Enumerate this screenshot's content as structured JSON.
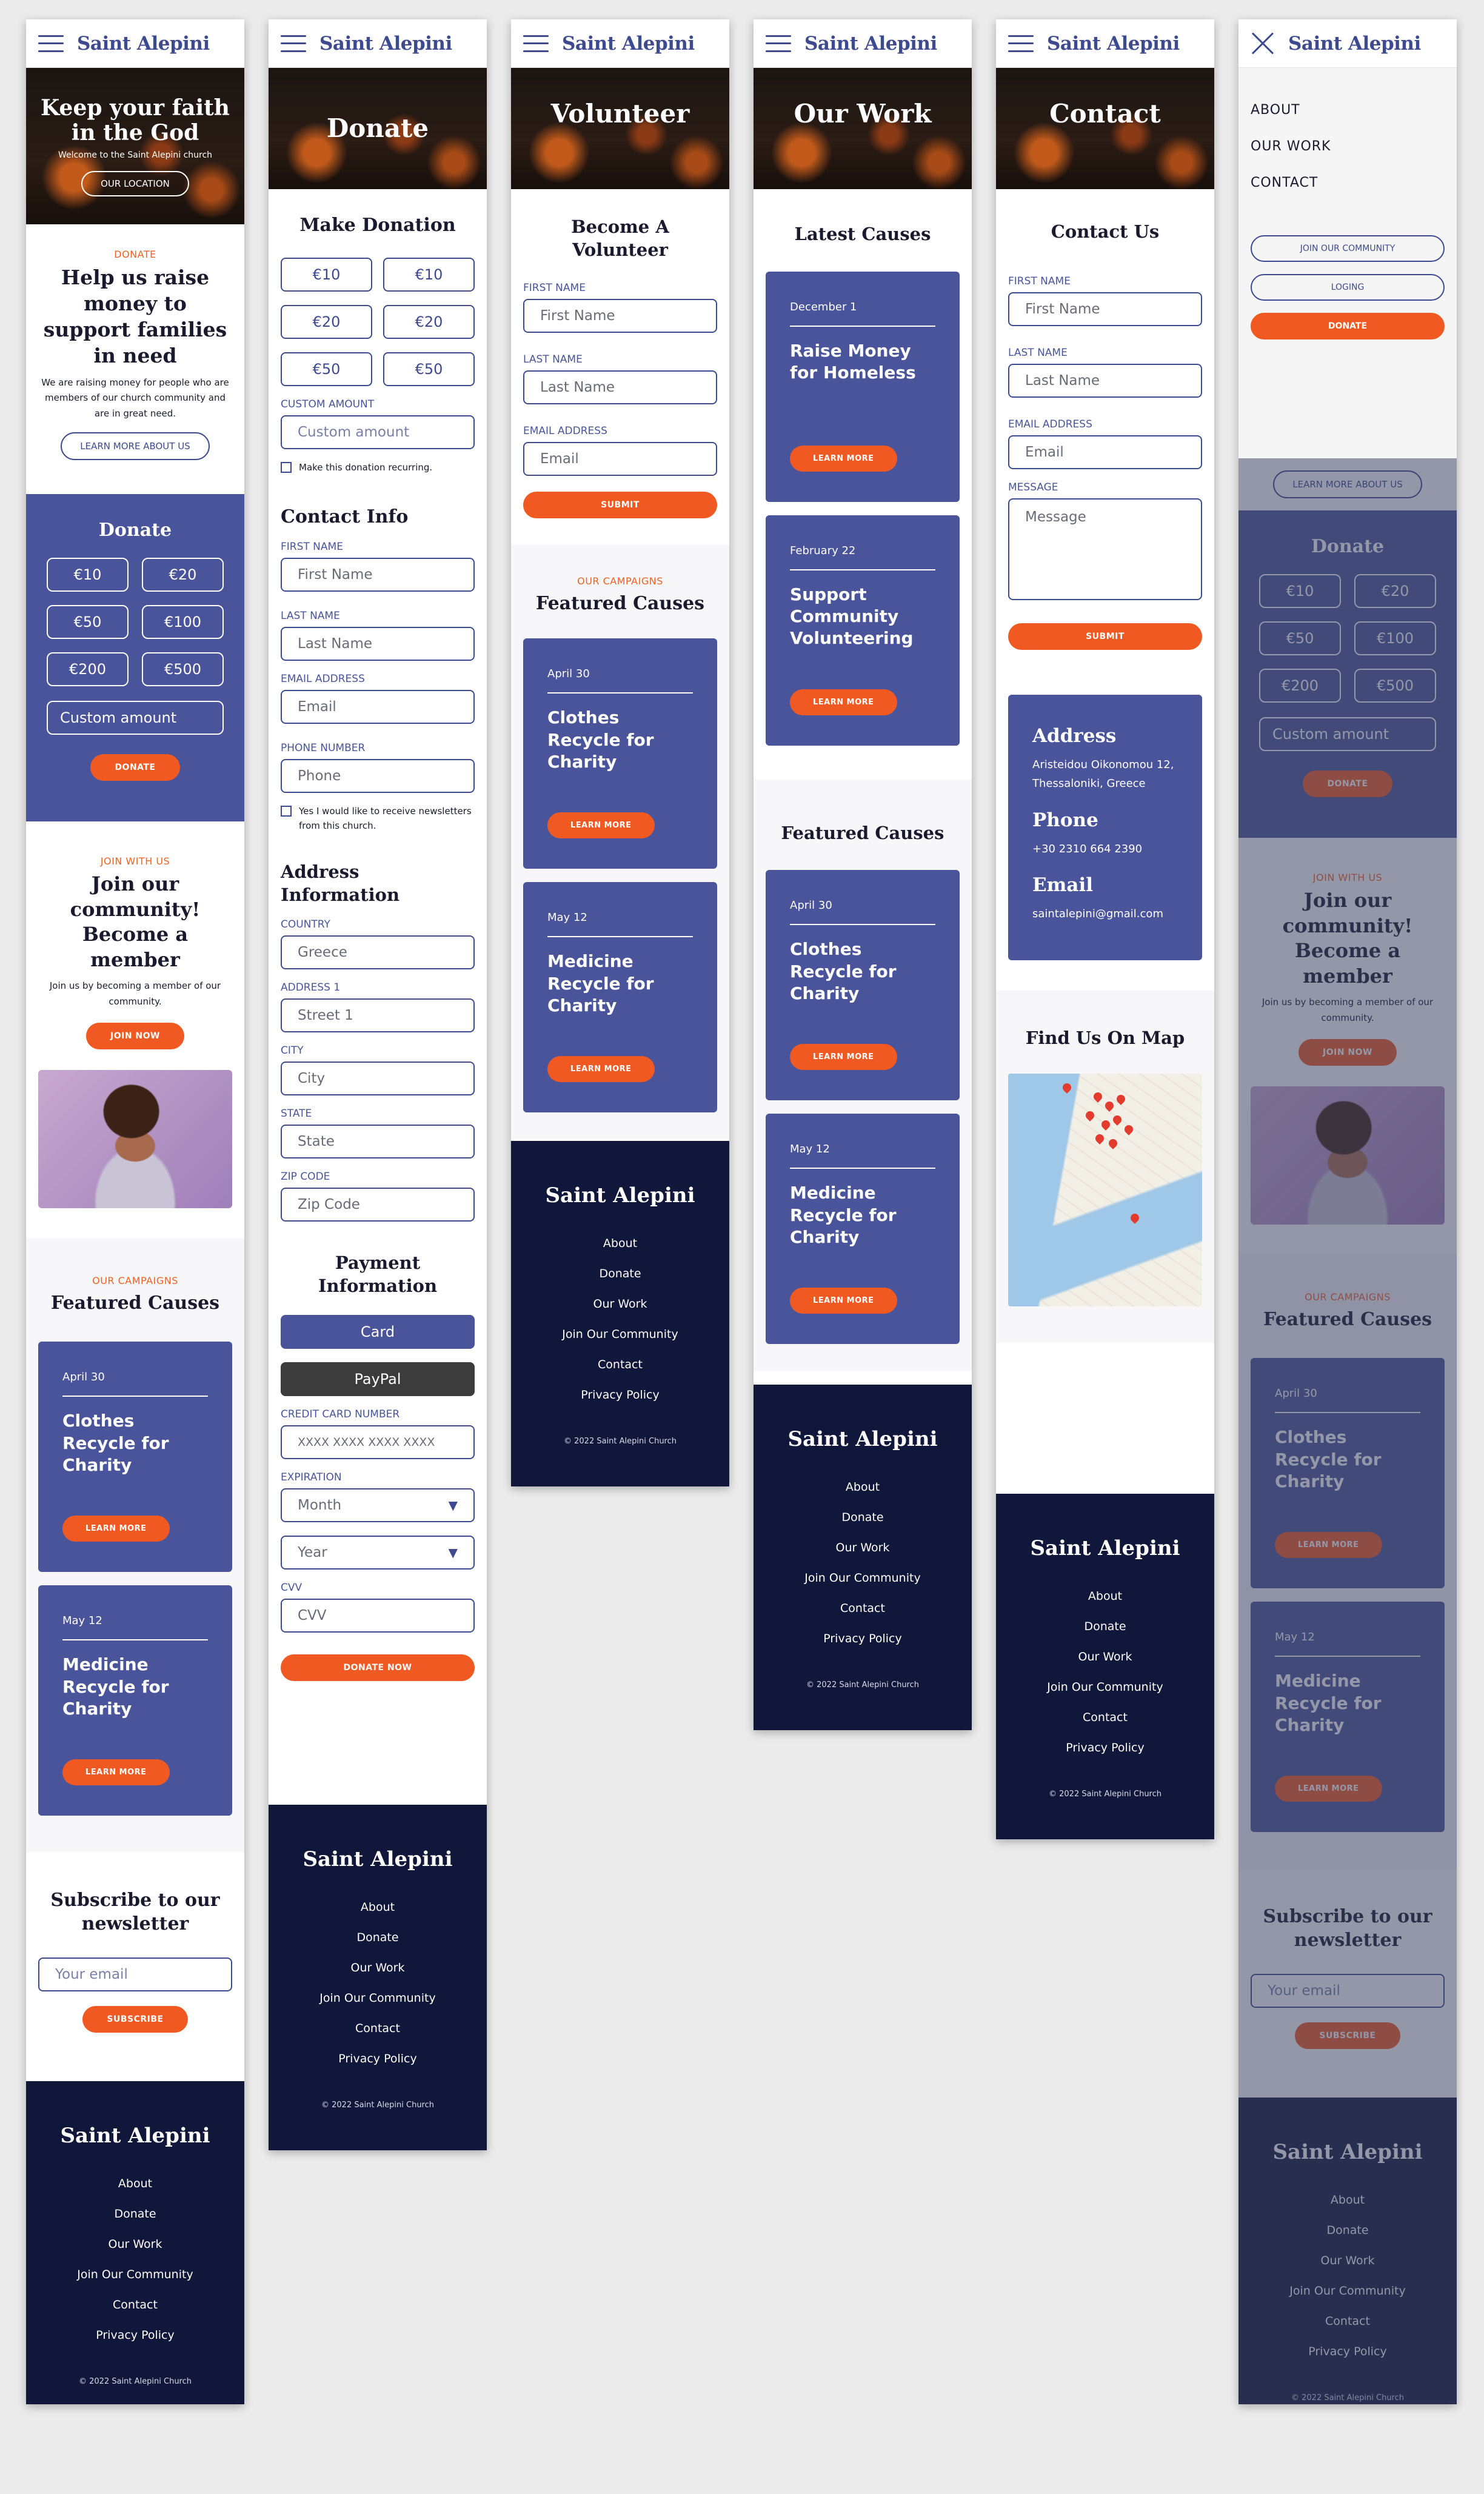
{
  "brand": "Saint Alepini",
  "home": {
    "hero_title": "Keep your faith in the God",
    "hero_sub": "Welcome to the Saint Alepini church",
    "hero_btn": "OUR LOCATION",
    "donate_eyebrow": "DONATE",
    "donate_title": "Help us raise money to support families in need",
    "donate_text": "We are raising money for people who are members of our church community and are in great need.",
    "learn_btn": "LEARN MORE ABOUT US",
    "donate_block_title": "Donate",
    "amounts": [
      "€10",
      "€20",
      "€50",
      "€100",
      "€200",
      "€500"
    ],
    "custom": "Custom amount",
    "donate_btn": "DONATE",
    "join_eyebrow": "JOIN WITH US",
    "join_title": "Join our community! Become a member",
    "join_text": "Join us by becoming a member of our community.",
    "join_btn": "JOIN NOW",
    "campaigns_eyebrow": "OUR CAMPAIGNS",
    "campaigns_title": "Featured Causes",
    "newsletter_title": "Subscribe to our newsletter",
    "email_ph": "Your email",
    "subscribe": "SUBSCRIBE"
  },
  "causes": {
    "clothes": {
      "date": "April 30",
      "title": "Clothes Recycle for Charity"
    },
    "medicine": {
      "date": "May 12",
      "title": "Medicine Recycle for Charity"
    },
    "homeless": {
      "date": "December 1",
      "title": "Raise Money for Homeless"
    },
    "volunteer": {
      "date": "February 22",
      "title": "Support Community Volunteering"
    },
    "learn_more": "LEARN MORE"
  },
  "donate": {
    "hero": "Donate",
    "make_title": "Make Donation",
    "amounts": [
      "€10",
      "€10",
      "€20",
      "€20",
      "€50",
      "€50"
    ],
    "custom_label": "CUSTOM AMOUNT",
    "custom_ph": "Custom amount",
    "recurring": "Make this donation recurring.",
    "contact_title": "Contact Info",
    "first_label": "FIRST NAME",
    "first_ph": "First Name",
    "last_label": "LAST NAME",
    "last_ph": "Last Name",
    "email_label": "EMAIL ADDRESS",
    "email_ph": "Email",
    "phone_label": "PHONE NUMBER",
    "phone_ph": "Phone",
    "newsletter_chk": "Yes I would like to receive newsletters from this church.",
    "address_title": "Address Information",
    "country_label": "COUNTRY",
    "country_val": "Greece",
    "addr_label": "ADDRESS 1",
    "addr_ph": "Street 1",
    "city_label": "CITY",
    "city_ph": "City",
    "state_label": "STATE",
    "state_ph": "State",
    "zip_label": "ZIP CODE",
    "zip_ph": "Zip Code",
    "payment_title": "Payment Information",
    "card": "Card",
    "paypal": "PayPal",
    "cc_label": "CREDIT CARD NUMBER",
    "cc_ph": "XXXX XXXX XXXX XXXX",
    "exp_label": "EXPIRATION",
    "month": "Month",
    "year": "Year",
    "cvv_label": "CVV",
    "cvv_ph": "CVV",
    "submit": "DONATE NOW"
  },
  "volunteer": {
    "hero": "Volunteer",
    "title": "Become A Volunteer",
    "first_label": "FIRST NAME",
    "first_ph": "First Name",
    "last_label": "LAST NAME",
    "last_ph": "Last Name",
    "email_label": "EMAIL ADDRESS",
    "email_ph": "Email",
    "submit": "SUBMIT",
    "campaigns_eyebrow": "OUR CAMPAIGNS",
    "campaigns_title": "Featured Causes"
  },
  "work": {
    "hero": "Our Work",
    "latest": "Latest Causes",
    "featured": "Featured Causes"
  },
  "contact": {
    "hero": "Contact",
    "title": "Contact Us",
    "first_label": "FIRST NAME",
    "first_ph": "First Name",
    "last_label": "LAST NAME",
    "last_ph": "Last Name",
    "email_label": "EMAIL ADDRESS",
    "email_ph": "Email",
    "msg_label": "MESSAGE",
    "msg_ph": "Message",
    "submit": "SUBMIT",
    "address_h": "Address",
    "address": "Aristeidou Oikonomou 12, Thessaloniki, Greece",
    "phone_h": "Phone",
    "phone": "+30 2310 664 2390",
    "email_h": "Email",
    "email": "saintalepini@gmail.com",
    "map_title": "Find Us On Map"
  },
  "menu": {
    "items": [
      "ABOUT",
      "OUR WORK",
      "CONTACT"
    ],
    "join": "JOIN OUR COMMUNITY",
    "login": "LOGING",
    "donate": "DONATE"
  },
  "footer": {
    "links": [
      "About",
      "Donate",
      "Our Work",
      "Join Our Community",
      "Contact",
      "Privacy Policy"
    ],
    "copy": "© 2022 Saint Alepini Church"
  },
  "colors": {
    "primary": "#49549a",
    "accent": "#f05a22",
    "footer": "#11173a"
  }
}
